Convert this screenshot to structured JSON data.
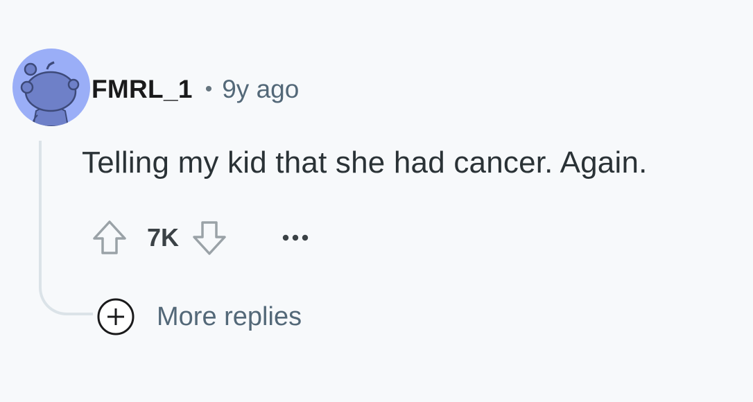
{
  "comment": {
    "author": "FMRL_1",
    "separator": "•",
    "age": "9y ago",
    "body": "Telling my kid that she had cancer. Again.",
    "score": "7K",
    "more_replies_label": "More replies"
  },
  "icons": {
    "avatar": "reddit-snoo-avatar-icon",
    "upvote": "arrow-up-outline-icon",
    "downvote": "arrow-down-outline-icon",
    "overflow": "ellipsis-icon",
    "expand": "plus-circle-icon"
  },
  "colors": {
    "background": "#f7f9fb",
    "avatar_background": "#9aaef7",
    "avatar_snoo": "#6e80c8",
    "username": "#1a1a1b",
    "meta_text": "#536878",
    "thread_line": "#dbe3e8"
  }
}
